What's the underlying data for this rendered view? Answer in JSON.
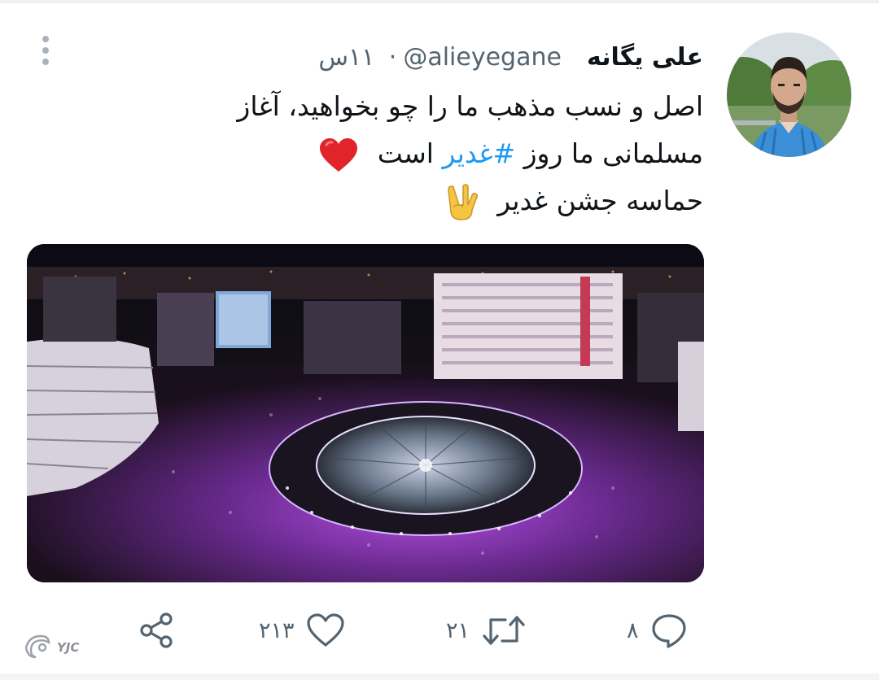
{
  "tweet": {
    "display_name": "علی یگانه",
    "handle": "@alieyegane",
    "separator": "·",
    "timestamp": "۱۱س",
    "text": {
      "line1": "اصل و نسب مذهب ما را چو بخواهید، آغاز",
      "line2_prefix": "مسلمانی ما روز",
      "hashtag": "#غدیر",
      "line2_suffix": "است",
      "line3": "حماسه جشن غدیر",
      "emoji_after_line2": "red-heart-icon",
      "emoji_after_line3": "victory-hand-icon"
    }
  },
  "actions": {
    "reply": {
      "icon": "reply-icon",
      "count": "۸"
    },
    "retweet": {
      "icon": "retweet-icon",
      "count": "۲۱"
    },
    "like": {
      "icon": "heart-outline-icon",
      "count": "۲۱۳"
    },
    "share": {
      "icon": "share-icon",
      "count": ""
    }
  },
  "watermark": {
    "text": "YJC",
    "icon": "yjc-logo-icon"
  },
  "colors": {
    "text_primary": "#0f1419",
    "text_secondary": "#536471",
    "hashtag": "#1d9bf0",
    "heart": "#e0242a"
  }
}
